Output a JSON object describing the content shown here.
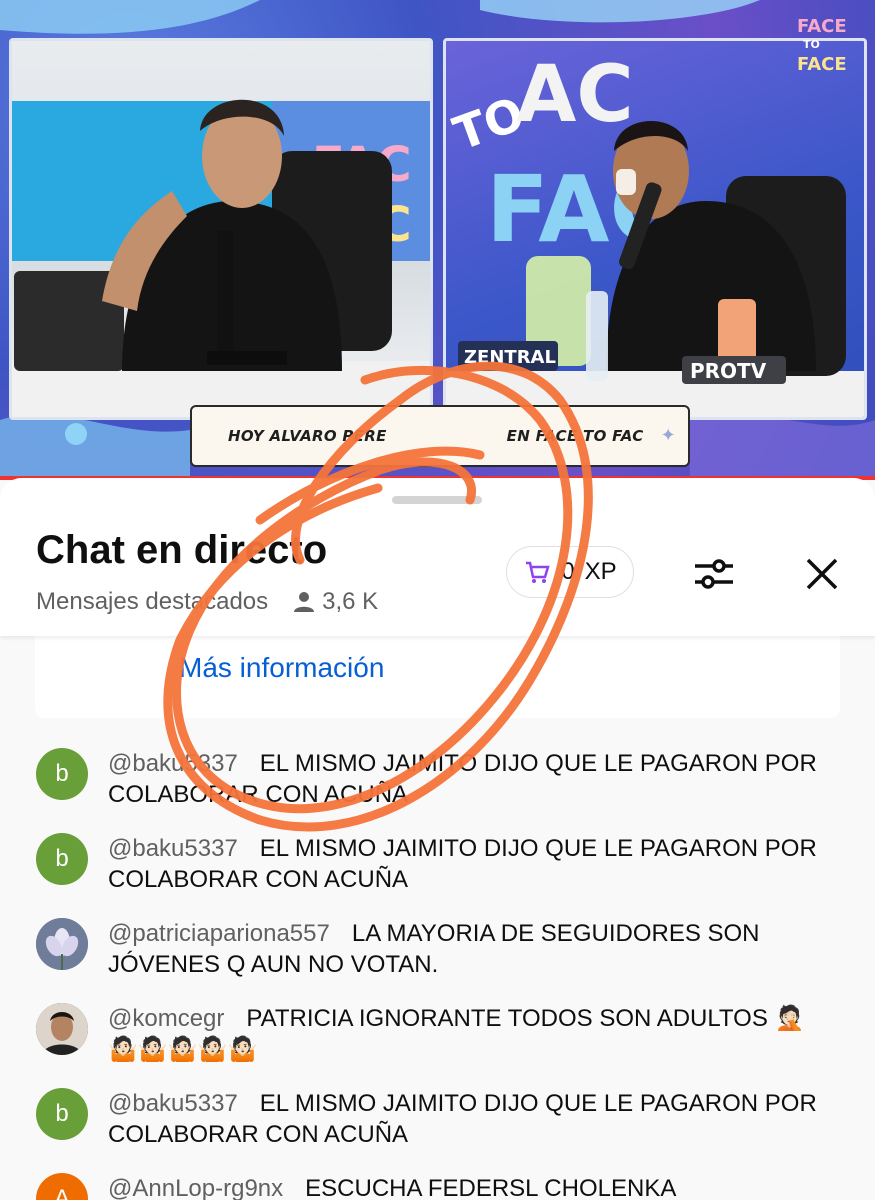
{
  "video": {
    "caption": "HOY ALVARO PERE",
    "caption_tail": "EN FACE TO FAC",
    "brand_logo_lines": [
      "FACE",
      "TO",
      "FACE"
    ],
    "left_sign": [
      "FAC",
      "FAC"
    ],
    "right_sign": [
      "TO",
      "AC",
      "FAC"
    ],
    "zentral_label": "ZENTRAL",
    "protv_label": "PROTV",
    "colors": {
      "accent": "#e33333",
      "background": "#4a5fcf"
    }
  },
  "chat": {
    "title": "Chat en directo",
    "subtitle": "Mensajes destacados",
    "viewer_count": "3,6 K",
    "xp_value": "0",
    "xp_unit": "XP",
    "more_info": "Más información",
    "icons": {
      "viewers": "person-icon",
      "xp": "cart-icon",
      "filter": "sliders-icon",
      "close": "close-icon"
    },
    "messages": [
      {
        "avatar_letter": "b",
        "avatar_color": "#689f38",
        "author": "@baku5337",
        "text": "EL MISMO JAIMITO DIJO QUE LE PAGARON POR COLABORAR CON ACUÑA"
      },
      {
        "avatar_letter": "b",
        "avatar_color": "#689f38",
        "author": "@baku5337",
        "text": "EL MISMO JAIMITO DIJO QUE LE PAGARON POR COLABORAR CON ACUÑA"
      },
      {
        "avatar_letter": "",
        "avatar_color": "#7f8aa3",
        "author": "@patriciapariona557",
        "text": "LA MAYORIA DE SEGUIDORES SON JÓVENES Q AUN NO VOTAN."
      },
      {
        "avatar_letter": "",
        "avatar_color": "#3b3b3b",
        "author": "@komcegr",
        "text": "PATRICIA IGNORANTE TODOS SON ADULTOS 🤦🏻🤷🏻🤷🏻🤷🏻🤷🏻🤷🏻"
      },
      {
        "avatar_letter": "b",
        "avatar_color": "#689f38",
        "author": "@baku5337",
        "text": "EL MISMO JAIMITO DIJO QUE LE PAGARON POR COLABORAR CON ACUÑA"
      },
      {
        "avatar_letter": "A",
        "avatar_color": "#ef6c00",
        "author": "@AnnLop-rg9nx",
        "text": "ESCUCHA FEDERSL CHOLENKA"
      }
    ]
  }
}
